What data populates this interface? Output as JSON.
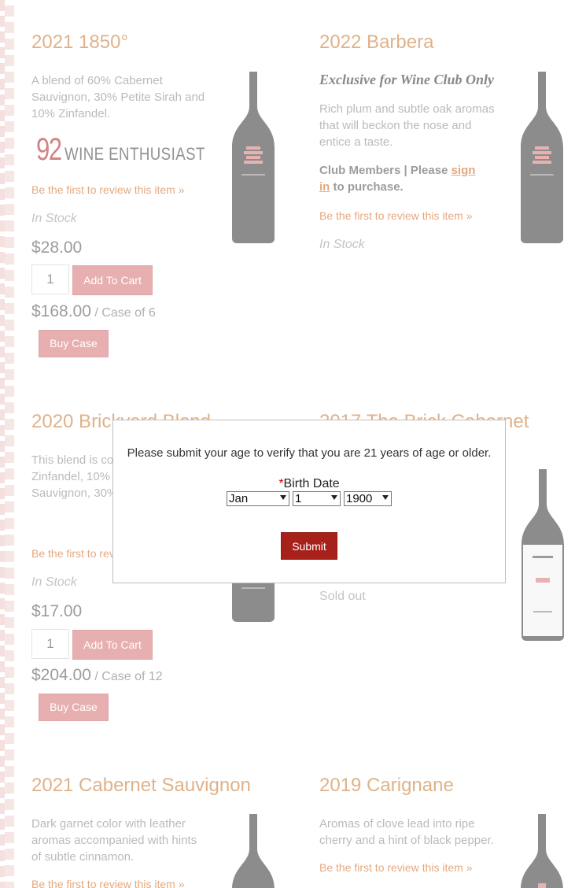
{
  "products": [
    {
      "title": "2021 1850°",
      "description": "A blend of 60% Cabernet Sauvignon, 30% Petite Sirah and 10% Zinfandel.",
      "rating": {
        "score": "92",
        "publication": "WINE ENTHUSIAST"
      },
      "review_link": "Be the first to review this item »",
      "stock": "In Stock",
      "price": "$28.00",
      "qty": "1",
      "add_to_cart": "Add To Cart",
      "case_price": "$168.00",
      "case_note": "/ Case of 6",
      "buy_case": "Buy Case"
    },
    {
      "title": "2022 Barbera",
      "exclusive": "Exclusive for Wine Club Only",
      "description": "Rich plum and subtle oak aromas that will beckon the nose and entice a taste.",
      "club_text_1": "Club Members | Please ",
      "club_link": "sign in",
      "club_text_2": " to purchase.",
      "review_link": "Be the first to review this item »",
      "stock": "In Stock"
    },
    {
      "title": "2020 Brickyard Blend",
      "description": "This blend is composed of 60% Zinfandel, 10% Cabernet Sauvignon, 30% Petite Sirah.",
      "review_link": "Be the first to review this item »",
      "stock": "In Stock",
      "price": "$17.00",
      "qty": "1",
      "add_to_cart": "Add To Cart",
      "case_price": "$204.00",
      "case_note": "/ Case of 12",
      "buy_case": "Buy Case"
    },
    {
      "title": "2017 The Brick Cabernet",
      "stock": "Sold out"
    },
    {
      "title": "2021 Cabernet Sauvignon",
      "description": "Dark garnet color with leather aromas accompanied with hints of subtle cinnamon.",
      "review_link": "Be the first to review this item »"
    },
    {
      "title": "2019 Carignane",
      "description": "Aromas of clove lead into ripe cherry and a hint of black pepper.",
      "review_link": "Be the first to review this item »"
    }
  ],
  "age_modal": {
    "message": "Please submit your age to verify that you are 21 years of age or older.",
    "required_mark": "*",
    "birth_date_label": "Birth Date",
    "month": "Jan",
    "day": "1",
    "year": "1900",
    "submit": "Submit"
  },
  "colors": {
    "title": "#c97b35",
    "link": "#d16a22",
    "button": "#d77777",
    "submit": "#a8201a",
    "bottle": "#3a3a3a"
  }
}
